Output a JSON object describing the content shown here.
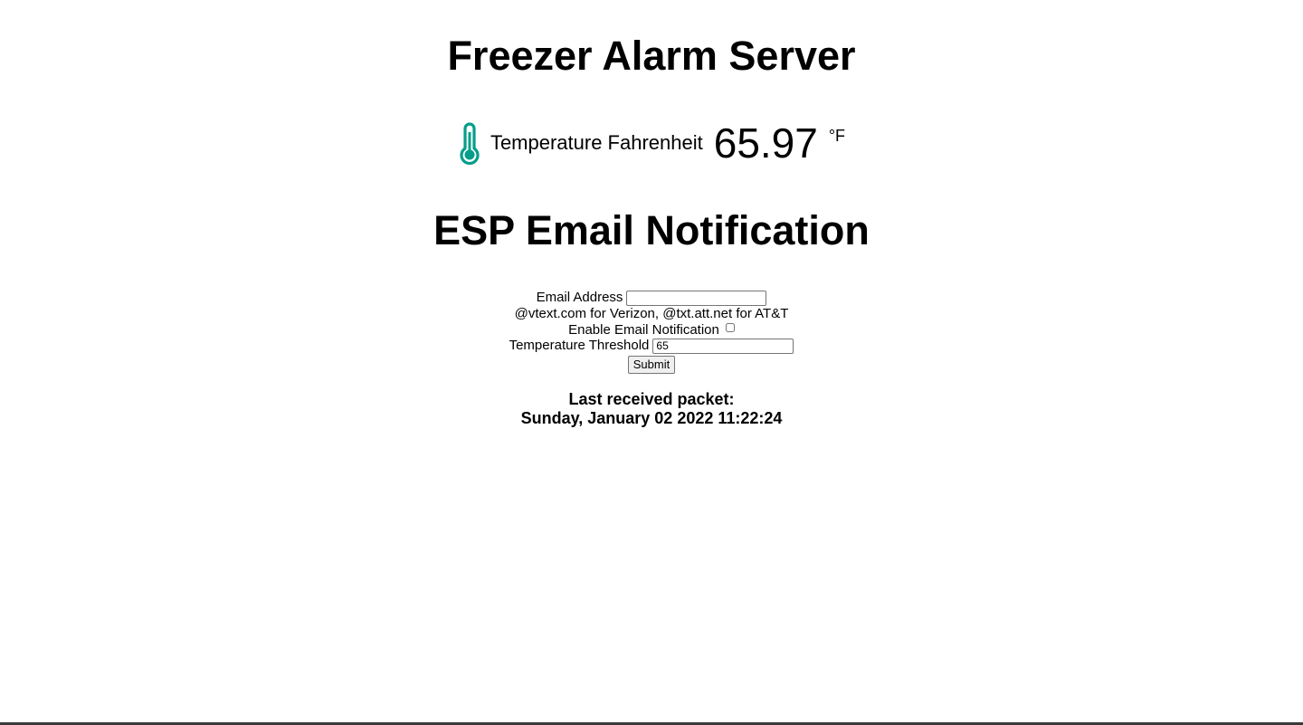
{
  "header": {
    "title": "Freezer Alarm Server"
  },
  "temperature": {
    "icon": "thermometer-icon",
    "icon_color": "#059e8a",
    "label": "Temperature Fahrenheit",
    "value": "65.97",
    "unit": "°F"
  },
  "notification": {
    "title": "ESP Email Notification",
    "email_label": "Email Address",
    "email_value": "",
    "hint": "@vtext.com for Verizon, @txt.att.net for AT&T",
    "enable_label": "Enable Email Notification",
    "enable_checked": false,
    "threshold_label": "Temperature Threshold",
    "threshold_value": "65",
    "submit_label": "Submit"
  },
  "packet": {
    "label": "Last received packet:",
    "timestamp": "Sunday, January 02 2022 11:22:24"
  }
}
